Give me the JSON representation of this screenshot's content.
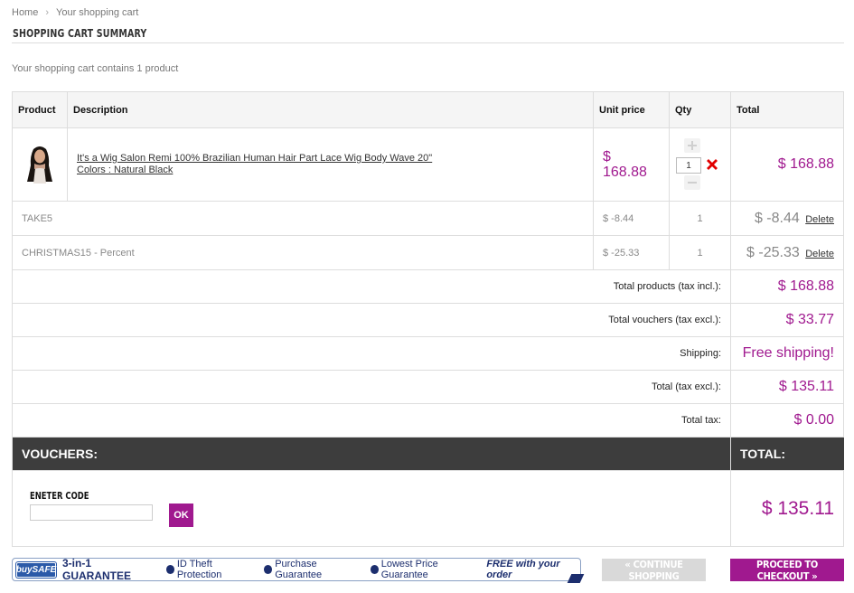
{
  "breadcrumb": {
    "home": "Home",
    "separator": "›",
    "current": "Your shopping cart"
  },
  "page_title": "SHOPPING CART SUMMARY",
  "cart_count_text": "Your shopping cart contains 1 product",
  "table": {
    "headers": {
      "product": "Product",
      "description": "Description",
      "unit_price": "Unit price",
      "qty": "Qty",
      "total": "Total"
    },
    "product": {
      "name": "It's a Wig Salon Remi 100% Brazilian Human Hair Part Lace Wig Body Wave 20\"",
      "attributes": "Colors : Natural Black",
      "unit_price_symbol": "$",
      "unit_price_value": "168.88",
      "qty": "1",
      "total": "$ 168.88",
      "image_icon": "product-thumbnail"
    },
    "vouchers": [
      {
        "name": "TAKE5",
        "price": "$ -8.44",
        "qty": "1",
        "total": "$ -8.44",
        "delete": "Delete"
      },
      {
        "name": "CHRISTMAS15 - Percent",
        "price": "$ -25.33",
        "qty": "1",
        "total": "$ -25.33",
        "delete": "Delete"
      }
    ],
    "summary": [
      {
        "label": "Total products (tax incl.):",
        "value": "$ 168.88"
      },
      {
        "label": "Total vouchers (tax excl.):",
        "value": "$ 33.77"
      },
      {
        "label": "Shipping:",
        "value": "Free shipping!"
      },
      {
        "label": "Total (tax excl.):",
        "value": "$ 135.11"
      },
      {
        "label": "Total tax:",
        "value": "$ 0.00"
      }
    ],
    "vouchers_heading": "VOUCHERS:",
    "total_heading": "TOTAL:",
    "code_label": "ENETER CODE",
    "code_value": "",
    "ok_button": "OK",
    "grand_total": "$ 135.11"
  },
  "guarantee": {
    "logo": "buySAFE",
    "main": "3-in-1 GUARANTEE",
    "items": [
      "ID Theft Protection",
      "Purchase Guarantee",
      "Lowest Price Guarantee"
    ],
    "free": "FREE with your order"
  },
  "buttons": {
    "continue": "« CONTINUE SHOPPING",
    "checkout": "PROCEED TO CHECKOUT »"
  },
  "colors": {
    "accent": "#a0198f",
    "bar": "#3d3d3d"
  }
}
